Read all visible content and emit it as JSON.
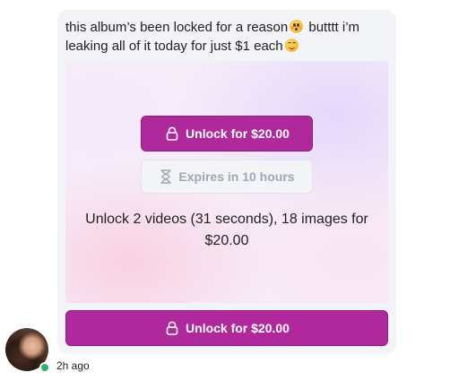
{
  "message": {
    "text_part1": "this album’s been locked for a reason",
    "emoji1": "flushed-face-emoji",
    "text_part2": " butttt i’m leaking all of it today for just $1 each",
    "emoji2": "smiling-face-emoji"
  },
  "locked_content": {
    "unlock_label": "Unlock for $20.00",
    "expires_label": "Expires in 10 hours",
    "description": "Unlock 2 videos (31 seconds), 18 images for $20.00"
  },
  "footer_unlock_label": "Unlock for $20.00",
  "sender": {
    "avatar_icon": "user-avatar",
    "online": true,
    "timestamp": "2h ago"
  },
  "colors": {
    "accent": "#b0299c",
    "bubble": "#f3f4f7",
    "online": "#2fb36b"
  }
}
